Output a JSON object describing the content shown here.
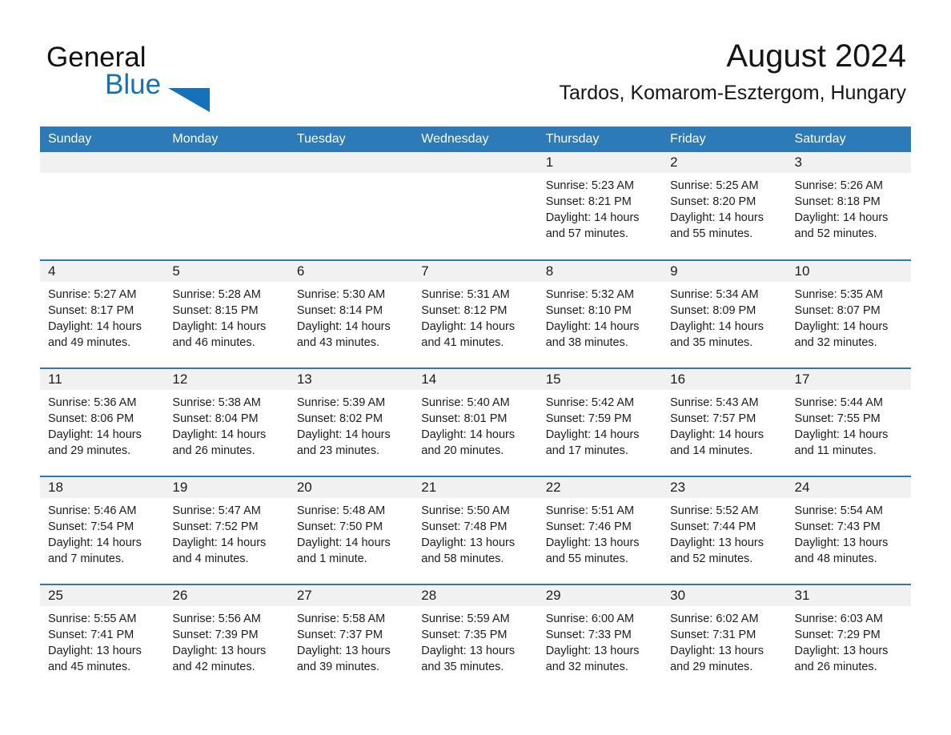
{
  "brand": {
    "name_part1": "General",
    "name_part2": "Blue",
    "triangle_color": "#1572ba",
    "text_color": "#111111",
    "accent_color": "#1572ba"
  },
  "header": {
    "title": "August 2024",
    "subtitle": "Tardos, Komarom-Esztergom, Hungary"
  },
  "theme": {
    "header_row_bg": "#2d7ab8",
    "header_row_text": "#ffffff",
    "daynum_bg": "#f1f1f1",
    "row_divider": "#2d7ab8",
    "page_bg": "#ffffff",
    "body_text": "#1d1d1d"
  },
  "weekday_headers": [
    "Sunday",
    "Monday",
    "Tuesday",
    "Wednesday",
    "Thursday",
    "Friday",
    "Saturday"
  ],
  "weeks": [
    [
      {
        "day": "",
        "empty": true,
        "sunrise": "",
        "sunset": "",
        "daylight_line1": "",
        "daylight_line2": ""
      },
      {
        "day": "",
        "empty": true,
        "sunrise": "",
        "sunset": "",
        "daylight_line1": "",
        "daylight_line2": ""
      },
      {
        "day": "",
        "empty": true,
        "sunrise": "",
        "sunset": "",
        "daylight_line1": "",
        "daylight_line2": ""
      },
      {
        "day": "",
        "empty": true,
        "sunrise": "",
        "sunset": "",
        "daylight_line1": "",
        "daylight_line2": ""
      },
      {
        "day": "1",
        "empty": false,
        "sunrise": "Sunrise: 5:23 AM",
        "sunset": "Sunset: 8:21 PM",
        "daylight_line1": "Daylight: 14 hours",
        "daylight_line2": "and 57 minutes."
      },
      {
        "day": "2",
        "empty": false,
        "sunrise": "Sunrise: 5:25 AM",
        "sunset": "Sunset: 8:20 PM",
        "daylight_line1": "Daylight: 14 hours",
        "daylight_line2": "and 55 minutes."
      },
      {
        "day": "3",
        "empty": false,
        "sunrise": "Sunrise: 5:26 AM",
        "sunset": "Sunset: 8:18 PM",
        "daylight_line1": "Daylight: 14 hours",
        "daylight_line2": "and 52 minutes."
      }
    ],
    [
      {
        "day": "4",
        "empty": false,
        "sunrise": "Sunrise: 5:27 AM",
        "sunset": "Sunset: 8:17 PM",
        "daylight_line1": "Daylight: 14 hours",
        "daylight_line2": "and 49 minutes."
      },
      {
        "day": "5",
        "empty": false,
        "sunrise": "Sunrise: 5:28 AM",
        "sunset": "Sunset: 8:15 PM",
        "daylight_line1": "Daylight: 14 hours",
        "daylight_line2": "and 46 minutes."
      },
      {
        "day": "6",
        "empty": false,
        "sunrise": "Sunrise: 5:30 AM",
        "sunset": "Sunset: 8:14 PM",
        "daylight_line1": "Daylight: 14 hours",
        "daylight_line2": "and 43 minutes."
      },
      {
        "day": "7",
        "empty": false,
        "sunrise": "Sunrise: 5:31 AM",
        "sunset": "Sunset: 8:12 PM",
        "daylight_line1": "Daylight: 14 hours",
        "daylight_line2": "and 41 minutes."
      },
      {
        "day": "8",
        "empty": false,
        "sunrise": "Sunrise: 5:32 AM",
        "sunset": "Sunset: 8:10 PM",
        "daylight_line1": "Daylight: 14 hours",
        "daylight_line2": "and 38 minutes."
      },
      {
        "day": "9",
        "empty": false,
        "sunrise": "Sunrise: 5:34 AM",
        "sunset": "Sunset: 8:09 PM",
        "daylight_line1": "Daylight: 14 hours",
        "daylight_line2": "and 35 minutes."
      },
      {
        "day": "10",
        "empty": false,
        "sunrise": "Sunrise: 5:35 AM",
        "sunset": "Sunset: 8:07 PM",
        "daylight_line1": "Daylight: 14 hours",
        "daylight_line2": "and 32 minutes."
      }
    ],
    [
      {
        "day": "11",
        "empty": false,
        "sunrise": "Sunrise: 5:36 AM",
        "sunset": "Sunset: 8:06 PM",
        "daylight_line1": "Daylight: 14 hours",
        "daylight_line2": "and 29 minutes."
      },
      {
        "day": "12",
        "empty": false,
        "sunrise": "Sunrise: 5:38 AM",
        "sunset": "Sunset: 8:04 PM",
        "daylight_line1": "Daylight: 14 hours",
        "daylight_line2": "and 26 minutes."
      },
      {
        "day": "13",
        "empty": false,
        "sunrise": "Sunrise: 5:39 AM",
        "sunset": "Sunset: 8:02 PM",
        "daylight_line1": "Daylight: 14 hours",
        "daylight_line2": "and 23 minutes."
      },
      {
        "day": "14",
        "empty": false,
        "sunrise": "Sunrise: 5:40 AM",
        "sunset": "Sunset: 8:01 PM",
        "daylight_line1": "Daylight: 14 hours",
        "daylight_line2": "and 20 minutes."
      },
      {
        "day": "15",
        "empty": false,
        "sunrise": "Sunrise: 5:42 AM",
        "sunset": "Sunset: 7:59 PM",
        "daylight_line1": "Daylight: 14 hours",
        "daylight_line2": "and 17 minutes."
      },
      {
        "day": "16",
        "empty": false,
        "sunrise": "Sunrise: 5:43 AM",
        "sunset": "Sunset: 7:57 PM",
        "daylight_line1": "Daylight: 14 hours",
        "daylight_line2": "and 14 minutes."
      },
      {
        "day": "17",
        "empty": false,
        "sunrise": "Sunrise: 5:44 AM",
        "sunset": "Sunset: 7:55 PM",
        "daylight_line1": "Daylight: 14 hours",
        "daylight_line2": "and 11 minutes."
      }
    ],
    [
      {
        "day": "18",
        "empty": false,
        "sunrise": "Sunrise: 5:46 AM",
        "sunset": "Sunset: 7:54 PM",
        "daylight_line1": "Daylight: 14 hours",
        "daylight_line2": "and 7 minutes."
      },
      {
        "day": "19",
        "empty": false,
        "sunrise": "Sunrise: 5:47 AM",
        "sunset": "Sunset: 7:52 PM",
        "daylight_line1": "Daylight: 14 hours",
        "daylight_line2": "and 4 minutes."
      },
      {
        "day": "20",
        "empty": false,
        "sunrise": "Sunrise: 5:48 AM",
        "sunset": "Sunset: 7:50 PM",
        "daylight_line1": "Daylight: 14 hours",
        "daylight_line2": "and 1 minute."
      },
      {
        "day": "21",
        "empty": false,
        "sunrise": "Sunrise: 5:50 AM",
        "sunset": "Sunset: 7:48 PM",
        "daylight_line1": "Daylight: 13 hours",
        "daylight_line2": "and 58 minutes."
      },
      {
        "day": "22",
        "empty": false,
        "sunrise": "Sunrise: 5:51 AM",
        "sunset": "Sunset: 7:46 PM",
        "daylight_line1": "Daylight: 13 hours",
        "daylight_line2": "and 55 minutes."
      },
      {
        "day": "23",
        "empty": false,
        "sunrise": "Sunrise: 5:52 AM",
        "sunset": "Sunset: 7:44 PM",
        "daylight_line1": "Daylight: 13 hours",
        "daylight_line2": "and 52 minutes."
      },
      {
        "day": "24",
        "empty": false,
        "sunrise": "Sunrise: 5:54 AM",
        "sunset": "Sunset: 7:43 PM",
        "daylight_line1": "Daylight: 13 hours",
        "daylight_line2": "and 48 minutes."
      }
    ],
    [
      {
        "day": "25",
        "empty": false,
        "sunrise": "Sunrise: 5:55 AM",
        "sunset": "Sunset: 7:41 PM",
        "daylight_line1": "Daylight: 13 hours",
        "daylight_line2": "and 45 minutes."
      },
      {
        "day": "26",
        "empty": false,
        "sunrise": "Sunrise: 5:56 AM",
        "sunset": "Sunset: 7:39 PM",
        "daylight_line1": "Daylight: 13 hours",
        "daylight_line2": "and 42 minutes."
      },
      {
        "day": "27",
        "empty": false,
        "sunrise": "Sunrise: 5:58 AM",
        "sunset": "Sunset: 7:37 PM",
        "daylight_line1": "Daylight: 13 hours",
        "daylight_line2": "and 39 minutes."
      },
      {
        "day": "28",
        "empty": false,
        "sunrise": "Sunrise: 5:59 AM",
        "sunset": "Sunset: 7:35 PM",
        "daylight_line1": "Daylight: 13 hours",
        "daylight_line2": "and 35 minutes."
      },
      {
        "day": "29",
        "empty": false,
        "sunrise": "Sunrise: 6:00 AM",
        "sunset": "Sunset: 7:33 PM",
        "daylight_line1": "Daylight: 13 hours",
        "daylight_line2": "and 32 minutes."
      },
      {
        "day": "30",
        "empty": false,
        "sunrise": "Sunrise: 6:02 AM",
        "sunset": "Sunset: 7:31 PM",
        "daylight_line1": "Daylight: 13 hours",
        "daylight_line2": "and 29 minutes."
      },
      {
        "day": "31",
        "empty": false,
        "sunrise": "Sunrise: 6:03 AM",
        "sunset": "Sunset: 7:29 PM",
        "daylight_line1": "Daylight: 13 hours",
        "daylight_line2": "and 26 minutes."
      }
    ]
  ]
}
